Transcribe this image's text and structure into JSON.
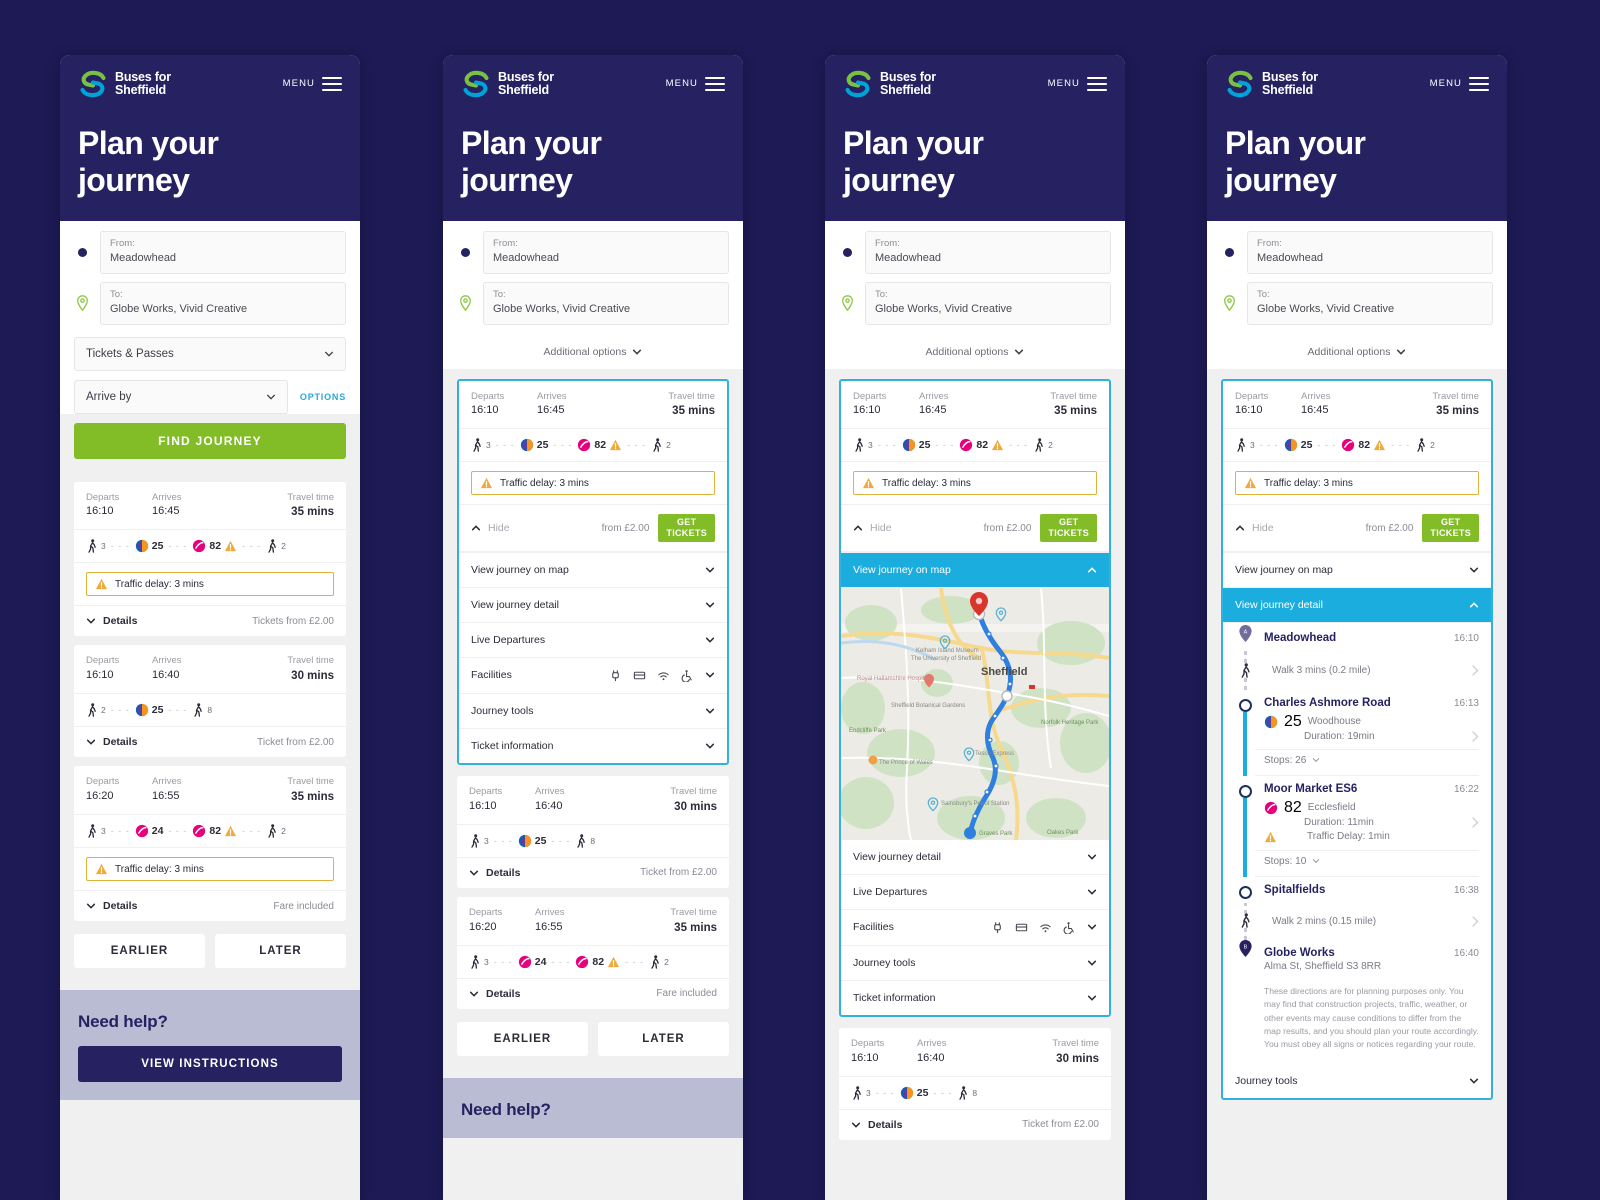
{
  "brand": {
    "line1": "Buses for",
    "line2": "Sheffield",
    "menu_label": "MENU"
  },
  "page_title": "Plan your\njourney",
  "form": {
    "from_label": "From:",
    "from_value": "Meadowhead",
    "to_label": "To:",
    "to_value": "Globe Works, Vivid Creative",
    "tickets_select": "Tickets & Passes",
    "time_select": "Arrive by",
    "options_link": "OPTIONS",
    "find_button": "FIND JOURNEY",
    "additional_options": "Additional options"
  },
  "labels": {
    "departs": "Departs",
    "arrives": "Arrives",
    "travel_time": "Travel time",
    "details": "Details",
    "hide": "Hide",
    "get_tickets": "GET\nTICKETS",
    "earlier": "EARLIER",
    "later": "LATER"
  },
  "journeys": [
    {
      "departs": "16:10",
      "arrives": "16:45",
      "travel_time": "35 mins",
      "legs": [
        {
          "type": "walk",
          "mins": "3"
        },
        {
          "type": "bus",
          "route": "25",
          "color": "#0d5fb5"
        },
        {
          "type": "bus",
          "route": "82",
          "color": "#e6007e",
          "warning": true
        },
        {
          "type": "walk",
          "mins": "2"
        }
      ],
      "delay": "Traffic delay: 3 mins",
      "fare": "Tickets from £2.00",
      "fare_expanded": "from £2.00"
    },
    {
      "departs": "16:10",
      "arrives": "16:40",
      "travel_time": "30 mins",
      "legs": [
        {
          "type": "walk",
          "mins": "3"
        },
        {
          "type": "bus",
          "route": "25",
          "color": "#0d5fb5"
        },
        {
          "type": "walk",
          "mins": "8"
        }
      ],
      "delay": null,
      "fare": "Ticket from £2.00"
    },
    {
      "departs": "16:20",
      "arrives": "16:55",
      "travel_time": "35 mins",
      "legs": [
        {
          "type": "walk",
          "mins": "3"
        },
        {
          "type": "bus",
          "route": "24",
          "color": "#e6007e"
        },
        {
          "type": "bus",
          "route": "82",
          "color": "#e6007e",
          "warning": true
        },
        {
          "type": "walk",
          "mins": "2"
        }
      ],
      "delay": "Traffic delay: 3 mins",
      "fare": "Fare included"
    }
  ],
  "panel1_first_card": {
    "departs": "16:10",
    "arrives": "16:45",
    "travel_time": "35 mins",
    "legs": [
      {
        "type": "walk",
        "mins": "3"
      },
      {
        "type": "bus",
        "route": "25",
        "color": "#0d5fb5"
      },
      {
        "type": "bus",
        "route": "82",
        "color": "#e6007e",
        "warning": true
      },
      {
        "type": "walk",
        "mins": "2"
      }
    ],
    "delay": "Traffic delay: 3 mins",
    "fare": "Tickets from £2.00"
  },
  "panel1_second_card": {
    "departs": "16:10",
    "arrives": "16:40",
    "travel_time": "30 mins",
    "legs": [
      {
        "type": "walk",
        "mins": "2"
      },
      {
        "type": "bus",
        "route": "25",
        "color": "#0d5fb5"
      },
      {
        "type": "walk",
        "mins": "8"
      }
    ],
    "fare": "Ticket from £2.00"
  },
  "accordion": [
    "View journey on map",
    "View journey detail",
    "Live Departures",
    "Facilities",
    "Journey tools",
    "Ticket information"
  ],
  "facilities_icons": [
    "usb-plug-icon",
    "card-reader-icon",
    "wifi-icon",
    "wheelchair-icon"
  ],
  "map": {
    "city": "Sheffield",
    "places": [
      "Kelham Island Museum",
      "The University of Sheffield",
      "Royal Hallamshire Hospital",
      "Sheffield Botanical Gardens",
      "Endcliffe Park",
      "Norfolk Heritage Park",
      "The Prince of Wales",
      "Tesco Express",
      "Sainsbury's Petrol Station",
      "Graves Park",
      "Oakes Park"
    ]
  },
  "journey_detail": {
    "steps": [
      {
        "kind": "origin",
        "marker": "A",
        "name": "Meadowhead",
        "time": "16:10"
      },
      {
        "kind": "walk",
        "mins": "3",
        "text": "Walk 3 mins (0.2 mile)"
      },
      {
        "kind": "stop",
        "name": "Charles Ashmore Road",
        "time": "16:13",
        "route": "25",
        "route_color": "#0d5fb5",
        "destination": "Woodhouse",
        "duration": "Duration: 19min",
        "stops": "Stops: 26"
      },
      {
        "kind": "stop",
        "name": "Moor Market ES6",
        "time": "16:22",
        "route": "82",
        "route_color": "#e6007e",
        "destination": "Ecclesfield",
        "duration": "Duration: 11min",
        "delay": "Traffic Delay: 1min",
        "stops": "Stops: 10"
      },
      {
        "kind": "stop-plain",
        "name": "Spitalfields",
        "time": "16:38"
      },
      {
        "kind": "walk",
        "mins": "2",
        "text": "Walk 2 mins (0.15 mile)"
      },
      {
        "kind": "destination",
        "marker": "B",
        "name": "Globe Works",
        "time": "16:40",
        "address": "Alma St, Sheffield S3 8RR"
      }
    ],
    "disclaimer": "These directions are for planning purposes only. You may find that construction projects, traffic, weather, or other events may cause conditions to differ from the map results, and you should plan your route accordingly. You must obey all signs or notices regarding your route.",
    "journey_tools": "Journey tools"
  },
  "help": {
    "title": "Need help?",
    "button": "VIEW INSTRUCTIONS"
  },
  "colors": {
    "brand_navy": "#262262",
    "accent_green": "#82bc26",
    "accent_cyan": "#1badde",
    "warning_amber": "#e6a817",
    "route_pink": "#e6007e",
    "route_blue": "#0d5fb5",
    "page_bg": "#1d1a55"
  }
}
